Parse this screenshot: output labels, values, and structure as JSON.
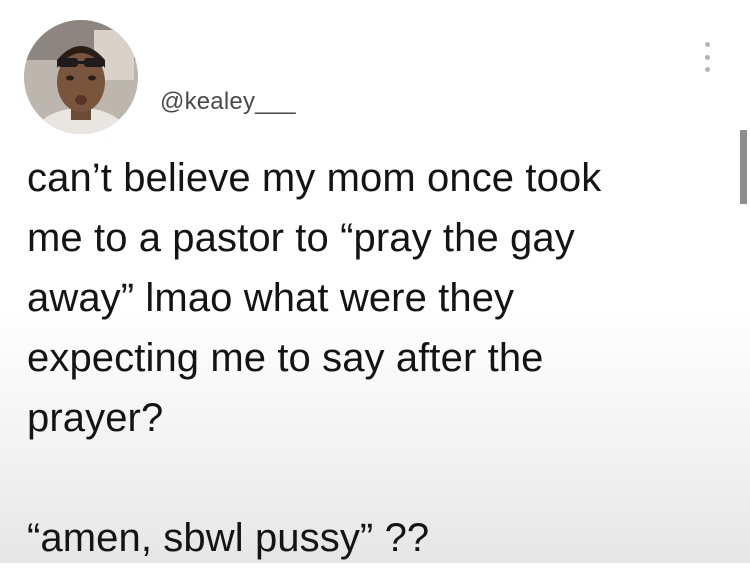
{
  "user": {
    "handle": "@kealey___",
    "avatar_icon": "profile-photo"
  },
  "tweet": {
    "paragraph_1": "can’t believe my mom once took\nme to a pastor to “pray the gay\naway” lmao what were they\nexpecting me to say after the\nprayer?",
    "paragraph_2": "“amen, sbwl pussy” ??"
  },
  "menu": {
    "icon": "more-vertical-icon"
  },
  "colors": {
    "text": "#141414",
    "handle": "#4a4a4a",
    "dots": "#b5b5b5",
    "scrollbar": "#8e8e8e"
  }
}
